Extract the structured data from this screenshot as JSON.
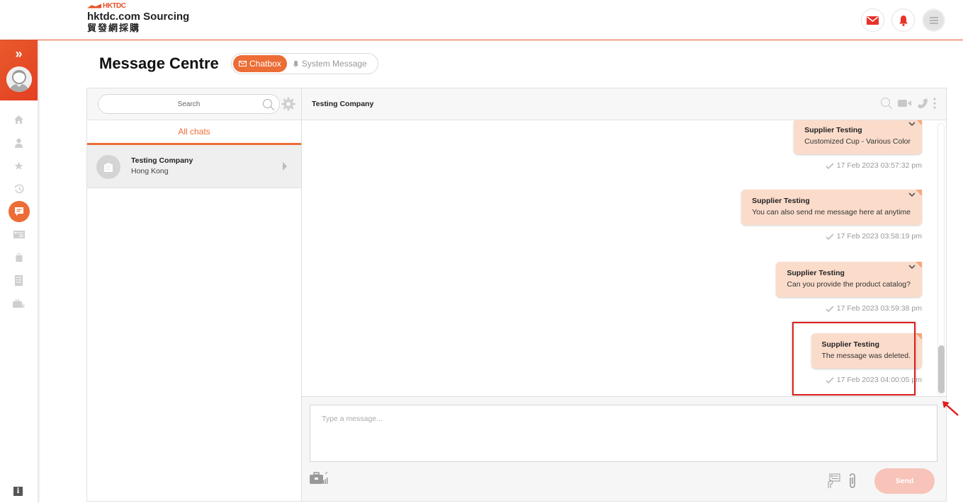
{
  "header": {
    "brand_small": "HKTDC",
    "brand_main": "hktdc.com Sourcing",
    "brand_cn": "貿發網採購",
    "icons": [
      "mail-icon",
      "bell-icon",
      "menu-icon"
    ],
    "accent_color": "#e8512a"
  },
  "rail": {
    "expand_label": "»",
    "items": [
      {
        "icon": "home-icon"
      },
      {
        "icon": "user-icon"
      },
      {
        "icon": "star-icon"
      },
      {
        "icon": "history-icon"
      },
      {
        "icon": "chat-icon",
        "active": true
      },
      {
        "icon": "card-icon"
      },
      {
        "icon": "bag-icon"
      },
      {
        "icon": "checklist-icon"
      },
      {
        "icon": "briefcase-chart-icon"
      }
    ],
    "info_label": "i"
  },
  "page": {
    "title": "Message Centre",
    "tabs": [
      {
        "label": "Chatbox",
        "icon": "mail-icon",
        "active": true
      },
      {
        "label": "System Message",
        "icon": "bell-icon",
        "active": false
      }
    ]
  },
  "sidebar": {
    "search_placeholder": "Search",
    "filter_label": "All chats",
    "chats": [
      {
        "name": "Testing Company",
        "location": "Hong Kong"
      }
    ]
  },
  "conversation": {
    "title": "Testing Company",
    "messages": [
      {
        "sender": "Supplier Testing",
        "text": "Customized Cup - Various Color",
        "timestamp": "17 Feb 2023 03:57:32 pm",
        "has_menu": true
      },
      {
        "sender": "Supplier Testing",
        "text": "You can also send me message here at anytime",
        "timestamp": "17 Feb 2023 03:58:19 pm",
        "has_menu": true
      },
      {
        "sender": "Supplier Testing",
        "text": "Can you provide the product catalog?",
        "timestamp": "17 Feb 2023 03:59:38 pm",
        "has_menu": true
      },
      {
        "sender": "Supplier Testing",
        "text": "The message was deleted.",
        "timestamp": "17 Feb 2023 04:00:05 pm",
        "has_menu": false
      }
    ]
  },
  "composer": {
    "placeholder": "Type a message...",
    "send_label": "Send"
  }
}
